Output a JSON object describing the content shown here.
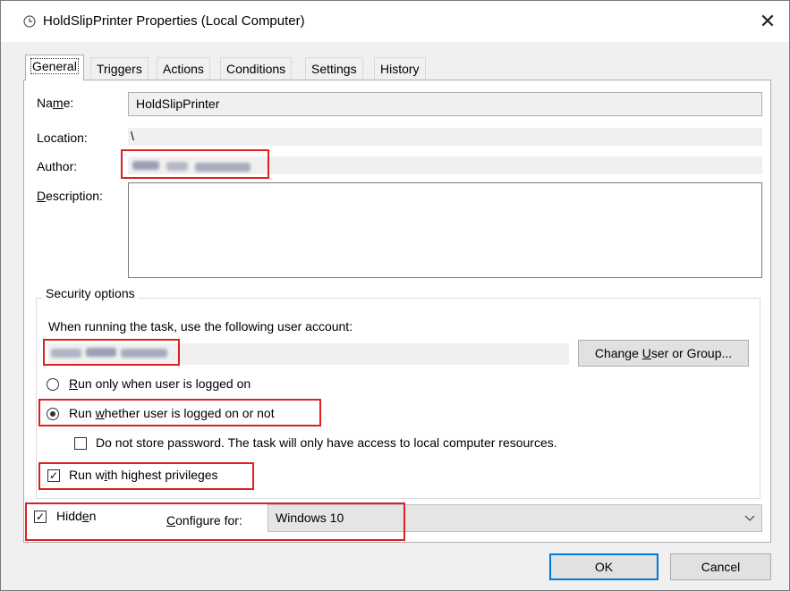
{
  "window": {
    "title": "HoldSlipPrinter Properties (Local Computer)",
    "close_label": "✕"
  },
  "tabs": [
    {
      "label": "General",
      "active": true
    },
    {
      "label": "Triggers"
    },
    {
      "label": "Actions"
    },
    {
      "label": "Conditions"
    },
    {
      "label": "Settings"
    },
    {
      "label": "History"
    }
  ],
  "general": {
    "name_label": "Name:",
    "name_value": "HoldSlipPrinter",
    "location_label": "Location:",
    "location_value": "\\",
    "author_label": "Author:",
    "description_label": "Description:",
    "description_value": ""
  },
  "security": {
    "group_title": "Security options",
    "account_prompt": "When running the task, use the following user account:",
    "change_user_button": "Change User or Group...",
    "radio_logged_on": "Run only when user is logged on",
    "radio_whether": "Run whether user is logged on or not",
    "radio_selected": "whether",
    "no_store_password": "Do not store password.  The task will only have access to local computer resources.",
    "no_store_password_checked": false,
    "highest_privileges": "Run with highest privileges",
    "highest_privileges_checked": true
  },
  "footer": {
    "hidden_label": "Hidden",
    "hidden_checked": true,
    "configure_label": "Configure for:",
    "configure_value": "Windows 10",
    "ok_label": "OK",
    "cancel_label": "Cancel"
  },
  "colors": {
    "highlight_red": "#e02020",
    "default_button_border": "#0078d7"
  }
}
